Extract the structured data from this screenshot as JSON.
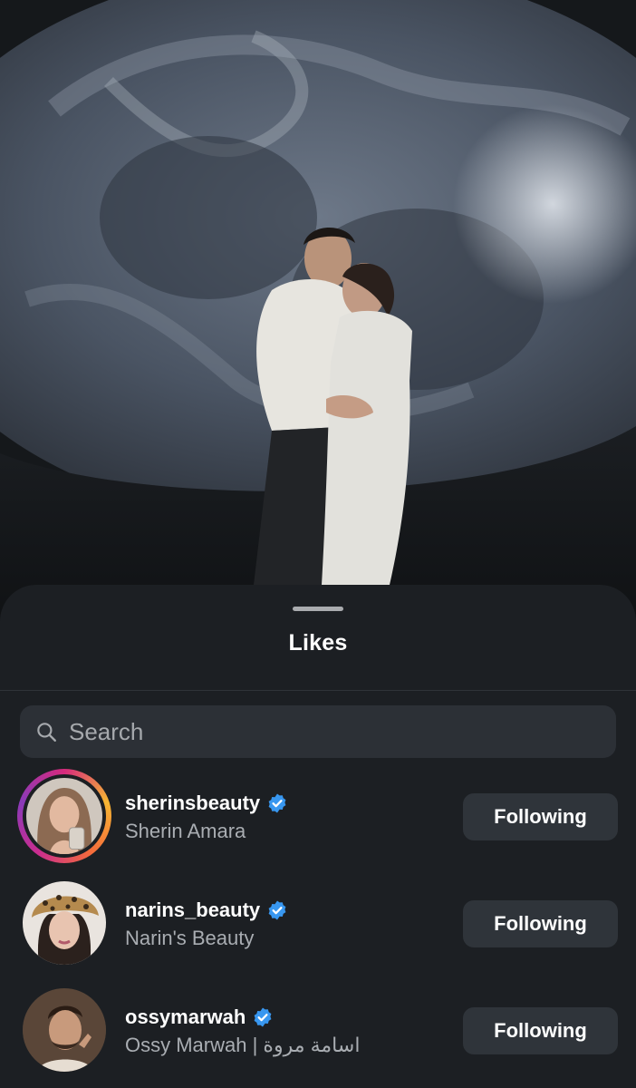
{
  "sheet": {
    "title": "Likes"
  },
  "search": {
    "placeholder": "Search",
    "icon": "search-icon"
  },
  "users": [
    {
      "username": "sherinsbeauty",
      "full_name": "Sherin Amara",
      "verified": true,
      "story_ring": true,
      "button_label": "Following"
    },
    {
      "username": "narins_beauty",
      "full_name": "Narin's Beauty",
      "verified": true,
      "story_ring": false,
      "button_label": "Following"
    },
    {
      "username": "ossymarwah",
      "full_name": "Ossy Marwah | اسامة مروة",
      "verified": true,
      "story_ring": false,
      "button_label": "Following"
    }
  ],
  "colors": {
    "sheet_background": "#1c1f23",
    "button_background": "#2f343a",
    "verified_badge": "#3897f0",
    "secondary_text": "#a9adb2"
  }
}
